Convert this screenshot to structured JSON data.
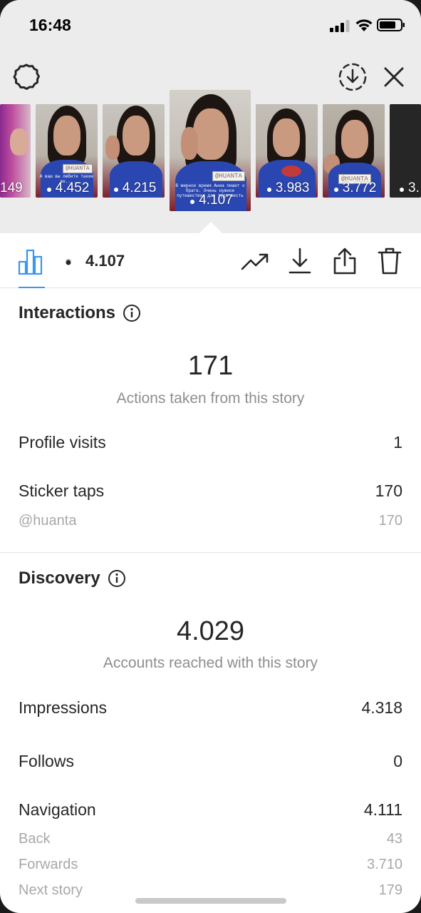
{
  "status_bar": {
    "time": "16:48"
  },
  "stories": [
    {
      "views": "149"
    },
    {
      "views": "4.452",
      "sticker": "@HUANTA",
      "caption": "А ваш вы любите такие же..."
    },
    {
      "views": "4.215"
    },
    {
      "views": "4.107",
      "sticker": "@HUANTA",
      "caption": "В мирное время Аниа пишет о Праге. Очень нужное путешествие для туда месть",
      "selected": true
    },
    {
      "views": "3.983"
    },
    {
      "views": "3.772",
      "sticker": "@HUANTA"
    },
    {
      "views": "3."
    }
  ],
  "toolbar": {
    "views": "4.107",
    "icons": [
      "bar-chart-icon",
      "eye-icon",
      "trend-icon",
      "download-icon",
      "share-icon",
      "trash-icon"
    ]
  },
  "interactions": {
    "title": "Interactions",
    "total": "171",
    "total_label": "Actions taken from this story",
    "rows": [
      {
        "label": "Profile visits",
        "value": "1"
      },
      {
        "label": "Sticker taps",
        "value": "170"
      }
    ],
    "sticker_detail": {
      "label": "@huanta",
      "value": "170"
    }
  },
  "discovery": {
    "title": "Discovery",
    "total": "4.029",
    "total_label": "Accounts reached with this story",
    "impressions": {
      "label": "Impressions",
      "value": "4.318"
    },
    "follows": {
      "label": "Follows",
      "value": "0"
    },
    "navigation": {
      "label": "Navigation",
      "value": "4.111"
    },
    "nav_rows": [
      {
        "label": "Back",
        "value": "43"
      },
      {
        "label": "Forwards",
        "value": "3.710"
      },
      {
        "label": "Next story",
        "value": "179"
      }
    ]
  },
  "colors": {
    "accent": "#3897f0",
    "muted": "#8e8e8e",
    "text": "#262626"
  }
}
